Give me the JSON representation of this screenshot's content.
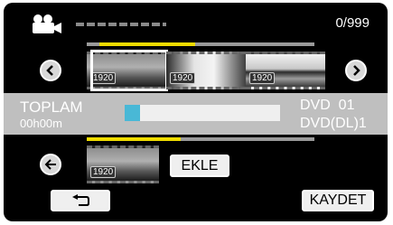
{
  "header": {
    "icon": "video-camera-icon",
    "counter": "0/999"
  },
  "top_strip": {
    "prev_icon": "chevron-left-icon",
    "next_icon": "chevron-right-icon",
    "thumbnails": [
      {
        "badge": "1920"
      },
      {
        "badge": "1920"
      },
      {
        "badge": "1920"
      }
    ]
  },
  "info": {
    "total_label": "TOPLAM",
    "total_time": "00h00m",
    "disc_line1": "DVD  01",
    "disc_line2": "DVD(DL)1",
    "progress_fraction": 0.1
  },
  "bottom_strip": {
    "back_icon": "arrow-left-icon",
    "thumbnails": [
      {
        "badge": "1920"
      }
    ],
    "add_label": "EKLE"
  },
  "footer": {
    "return_icon": "return-arrow-icon",
    "save_label": "KAYDET"
  },
  "colors": {
    "highlight": "#f0dc00",
    "progress": "#49b8d6",
    "band": "#bfbfbf"
  }
}
